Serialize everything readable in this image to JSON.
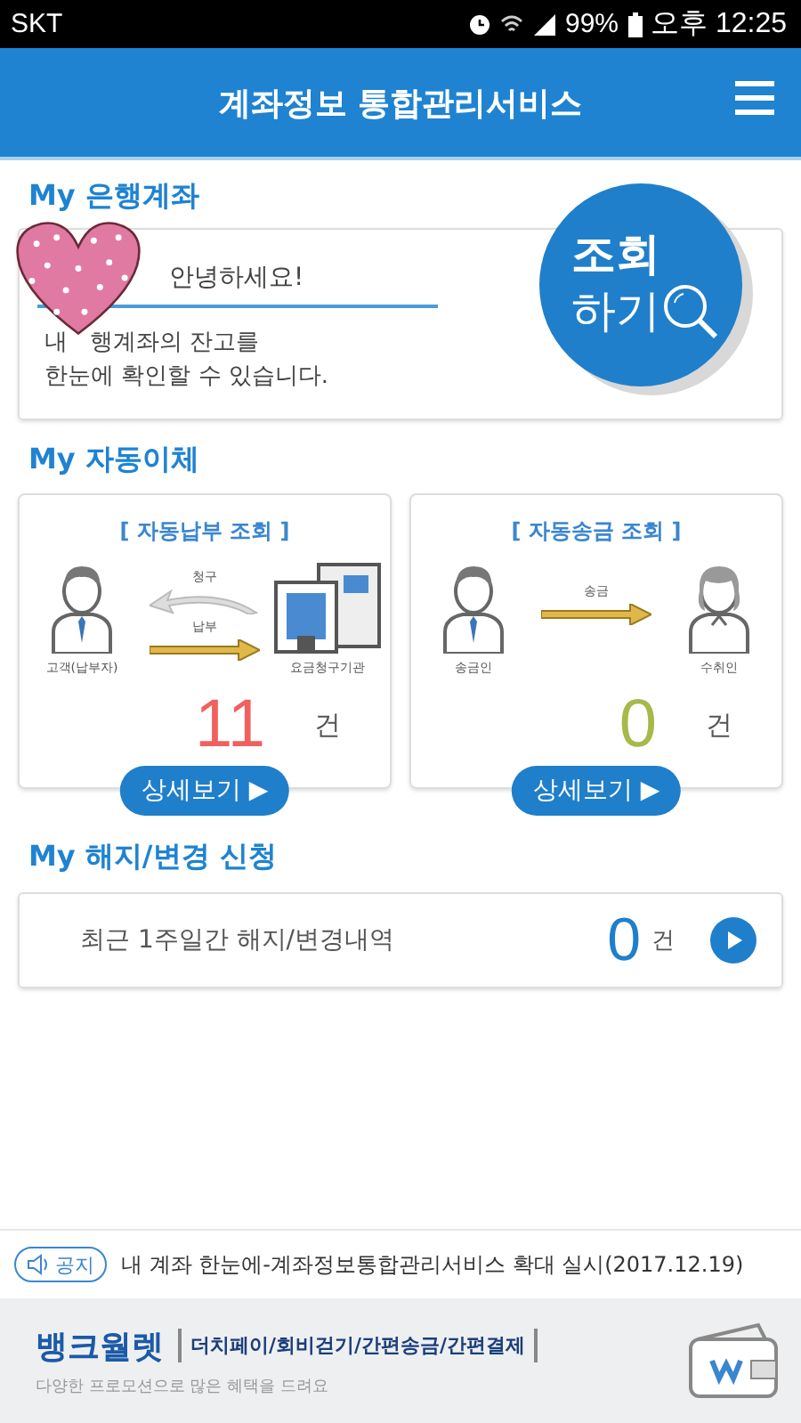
{
  "status_bar": {
    "carrier": "SKT",
    "battery": "99%",
    "time": "오후 12:25"
  },
  "header": {
    "title": "계좌정보 통합관리서비스"
  },
  "bank_account": {
    "title": "My 은행계좌",
    "greeting": "안녕하세요!",
    "description": "내   행계좌의 잔고를\n한눈에 확인할 수 있습니다.",
    "lookup_button": [
      "조회",
      "하기"
    ]
  },
  "auto_transfer": {
    "title": "My 자동이체",
    "cards": [
      {
        "kind": "payment",
        "title": "[ 자동납부 조회 ]",
        "arrow_labels": [
          "청구",
          "납부"
        ],
        "from_label": "고객(납부자)",
        "to_label": "요금청구기관",
        "count": "11",
        "unit": "건",
        "color": "#f0605e",
        "button": "상세보기 ▶"
      },
      {
        "kind": "remittance",
        "title": "[ 자동송금 조회 ]",
        "arrow_labels": [
          "송금"
        ],
        "from_label": "송금인",
        "to_label": "수취인",
        "count": "0",
        "unit": "건",
        "color": "#a8b84a",
        "button": "상세보기 ▶"
      }
    ]
  },
  "cancellation": {
    "title": "My 해지/변경 신청",
    "label": "최근 1주일간 해지/변경내역",
    "count": "0",
    "unit": "건"
  },
  "notice": {
    "badge": "공지",
    "text": "내 계좌 한눈에-계좌정보통합관리서비스 확대 실시(2017.12.19)"
  },
  "banner": {
    "brand": "뱅크월렛",
    "features": "더치페이/회비걷기/간편송금/간편결제",
    "subtitle": "다양한 프로모션으로 많은 혜택을 드려요"
  }
}
